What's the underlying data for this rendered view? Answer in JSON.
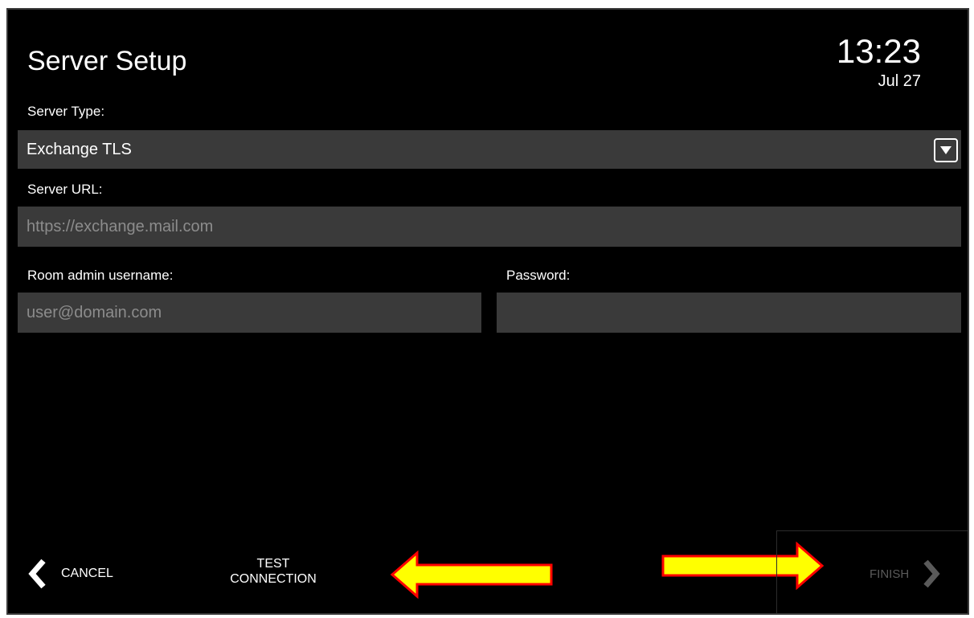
{
  "header": {
    "title": "Server Setup",
    "time": "13:23",
    "date": "Jul 27"
  },
  "form": {
    "server_type": {
      "label": "Server Type:",
      "value": "Exchange TLS"
    },
    "server_url": {
      "label": "Server URL:",
      "placeholder": "https://exchange.mail.com"
    },
    "username": {
      "label": "Room admin username:",
      "placeholder": "user@domain.com"
    },
    "password": {
      "label": "Password:",
      "value": ""
    }
  },
  "footer": {
    "cancel_label": "CANCEL",
    "test_line1": "TEST",
    "test_line2": "CONNECTION",
    "finish_label": "FINISH"
  },
  "colors": {
    "background": "#000000",
    "field_background": "#3a3a3a",
    "placeholder_text": "#8c8c8c",
    "annotation_arrow_fill": "#ffff00",
    "annotation_arrow_outline": "#ff0000",
    "disabled_text": "#5a5a5a"
  },
  "icons": {
    "dropdown": "dropdown-arrow-icon",
    "back": "chevron-left-icon",
    "forward": "chevron-right-icon"
  }
}
